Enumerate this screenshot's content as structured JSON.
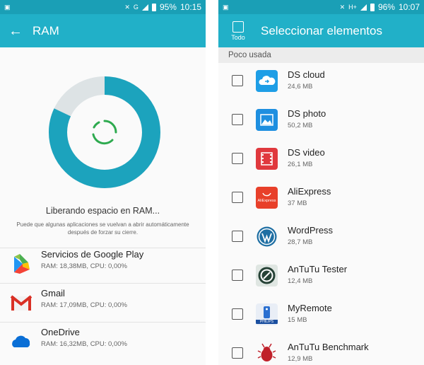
{
  "left": {
    "status": {
      "battery": "95%",
      "time": "10:15"
    },
    "appbar": {
      "title": "RAM"
    },
    "freeing_text": "Liberando espacio en RAM...",
    "note": "Puede que algunas aplicaciones se vuelvan a abrir automáticamente después de forzar su cierre.",
    "ram_usage_fraction": 0.82,
    "apps": [
      {
        "name": "Servicios de Google Play",
        "info": "RAM: 18,38MB, CPU: 0,00%",
        "icon": "google-play-services-icon"
      },
      {
        "name": "Gmail",
        "info": "RAM: 17,09MB, CPU: 0,00%",
        "icon": "gmail-icon"
      },
      {
        "name": "OneDrive",
        "info": "RAM: 16,32MB, CPU: 0,00%",
        "icon": "onedrive-icon"
      }
    ]
  },
  "right": {
    "status": {
      "battery": "96%",
      "time": "10:07"
    },
    "appbar": {
      "select_all_label": "Todo",
      "title": "Seleccionar elementos"
    },
    "section_header": "Poco usada",
    "items": [
      {
        "name": "DS cloud",
        "size": "24,6 MB",
        "icon": "ds-cloud-icon"
      },
      {
        "name": "DS photo",
        "size": "50,2 MB",
        "icon": "ds-photo-icon"
      },
      {
        "name": "DS video",
        "size": "26,1 MB",
        "icon": "ds-video-icon"
      },
      {
        "name": "AliExpress",
        "size": "37 MB",
        "icon": "aliexpress-icon",
        "icon_text": "AliExpress"
      },
      {
        "name": "WordPress",
        "size": "28,7 MB",
        "icon": "wordpress-icon"
      },
      {
        "name": "AnTuTu Tester",
        "size": "12,4 MB",
        "icon": "antutu-tester-icon"
      },
      {
        "name": "MyRemote",
        "size": "15 MB",
        "icon": "myremote-icon",
        "icon_text": "PHILIPS"
      },
      {
        "name": "AnTuTu Benchmark",
        "size": "12,9 MB",
        "icon": "antutu-benchmark-icon"
      }
    ]
  },
  "colors": {
    "status_bar": "#1a9fb6",
    "app_bar": "#21b0c8",
    "ring": "#1ca3bd",
    "ring_free": "#dde3e5",
    "spinner": "#2eaa4f"
  }
}
